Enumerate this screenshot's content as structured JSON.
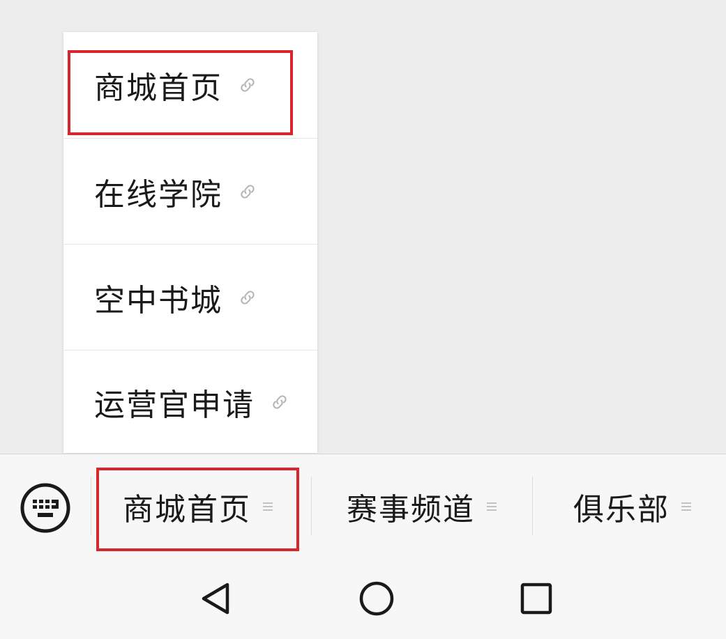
{
  "popup_menu": {
    "items": [
      {
        "label": "商城首页",
        "icon": "link-icon"
      },
      {
        "label": "在线学院",
        "icon": "link-icon"
      },
      {
        "label": "空中书城",
        "icon": "link-icon"
      },
      {
        "label": "运营官申请",
        "icon": "link-icon"
      }
    ]
  },
  "menu_bar": {
    "keyboard_icon": "keyboard-icon",
    "tabs": [
      {
        "label": "商城首页",
        "icon": "menu-lines-icon"
      },
      {
        "label": "赛事频道",
        "icon": "menu-lines-icon"
      },
      {
        "label": "俱乐部",
        "icon": "menu-lines-icon"
      }
    ]
  },
  "nav_bar": {
    "buttons": [
      "back-icon",
      "home-icon",
      "recents-icon"
    ]
  },
  "colors": {
    "highlight": "#d9262c",
    "background": "#ededed",
    "bar_background": "#f7f7f7",
    "text": "#1a1a1a",
    "icon_gray": "#b5b5b5"
  }
}
